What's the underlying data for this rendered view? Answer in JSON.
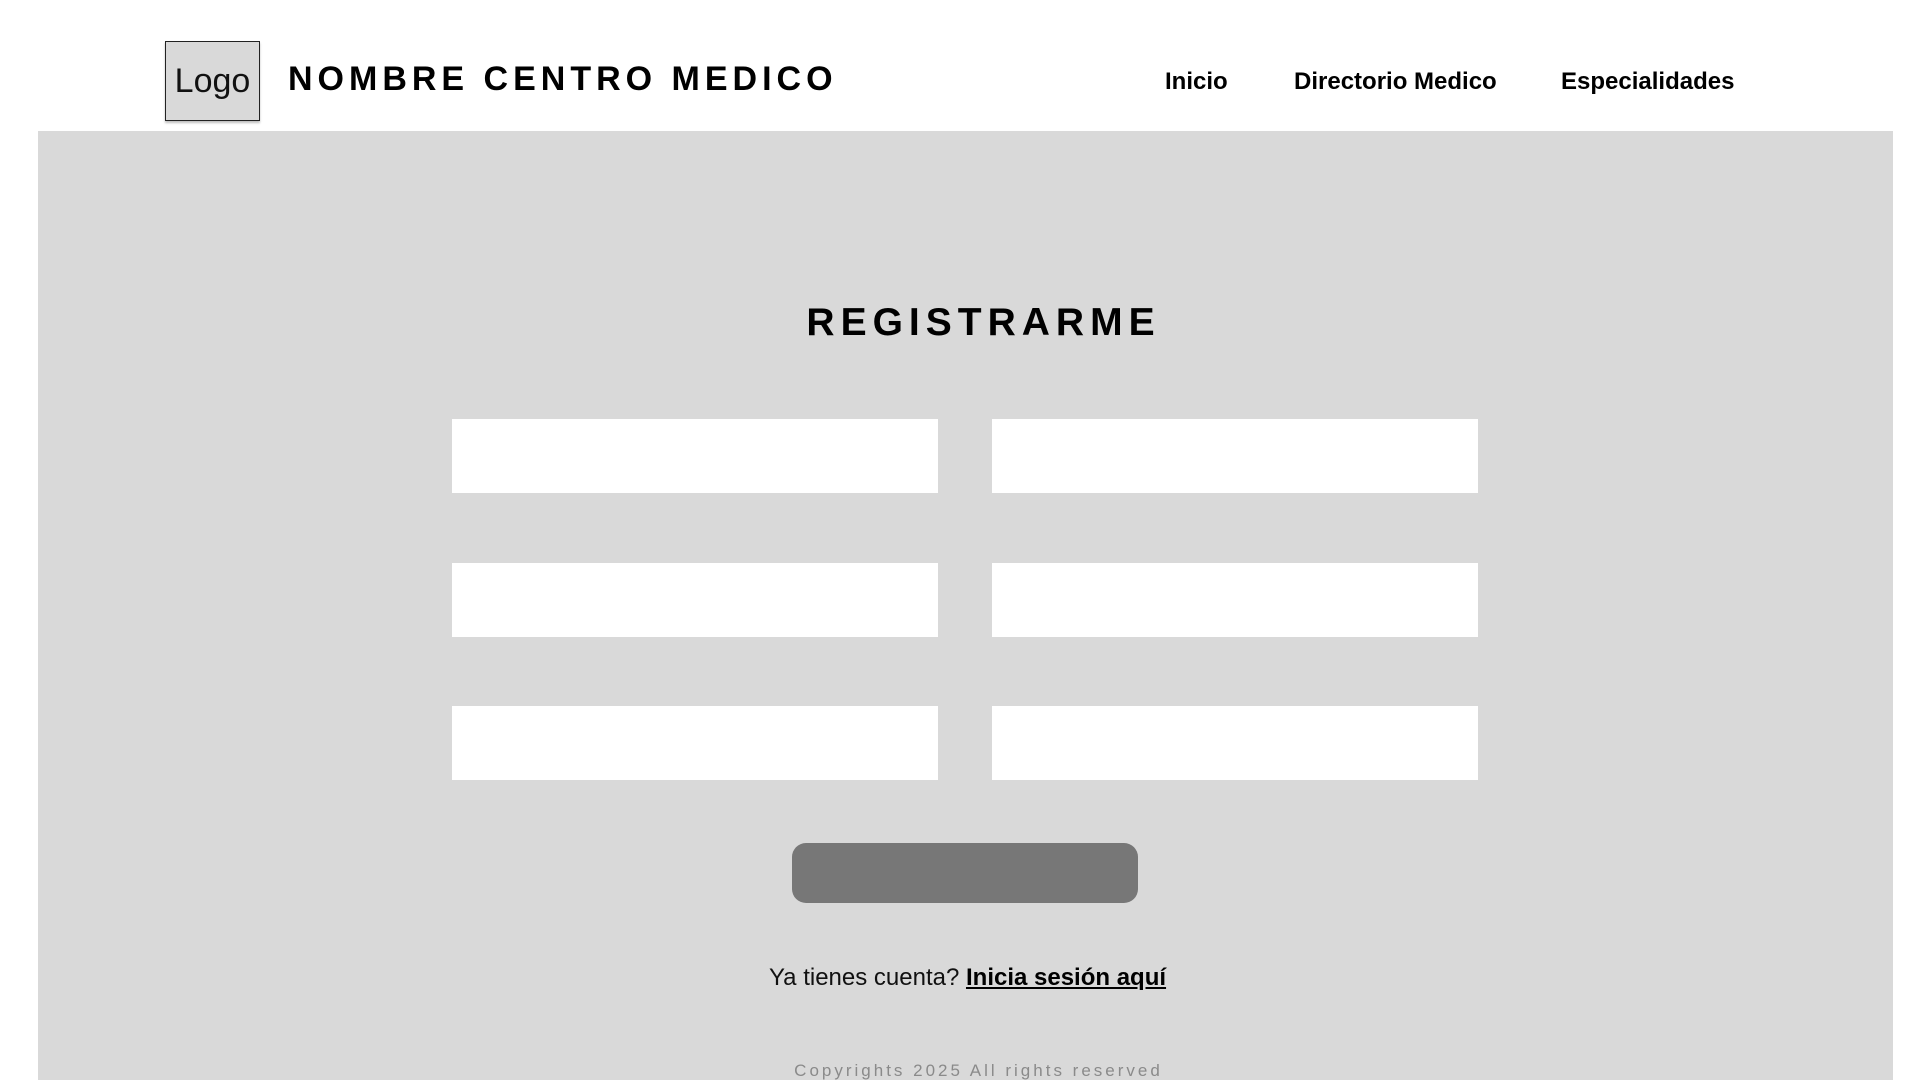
{
  "header": {
    "logo_label": "Logo",
    "site_title": "NOMBRE CENTRO MEDICO",
    "nav": [
      {
        "label": "Inicio"
      },
      {
        "label": "Directorio Medico"
      },
      {
        "label": "Especialidades"
      }
    ]
  },
  "register": {
    "title": "REGISTRARME",
    "fields": [
      {
        "value": "",
        "placeholder": ""
      },
      {
        "value": "",
        "placeholder": ""
      },
      {
        "value": "",
        "placeholder": ""
      },
      {
        "value": "",
        "placeholder": ""
      },
      {
        "value": "",
        "placeholder": ""
      },
      {
        "value": "",
        "placeholder": ""
      }
    ],
    "submit_label": "",
    "login_prompt": "Ya tienes cuenta?",
    "login_link": "Inicia sesión aquí"
  },
  "footer": {
    "copyright": "Copyrights 2025 All rights reserved"
  },
  "colors": {
    "background": "#d9d9d9",
    "field": "#ffffff",
    "button": "#777777",
    "muted_text": "#8a8a8a"
  }
}
